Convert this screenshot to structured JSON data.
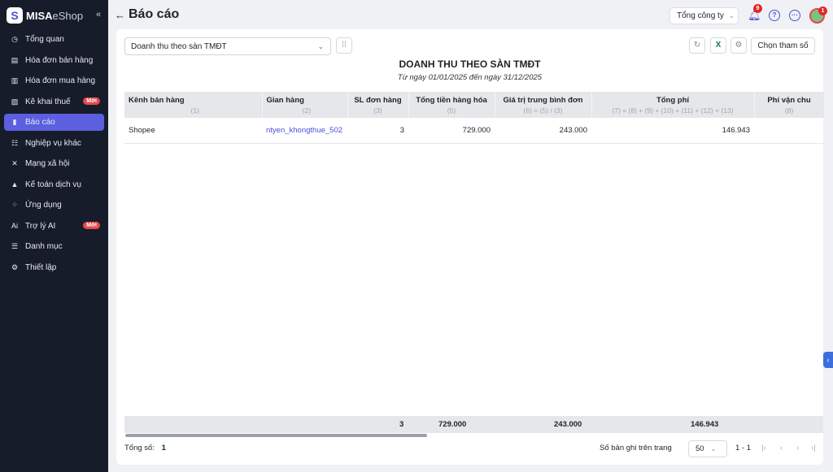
{
  "brand": {
    "mark": "S",
    "name_bold": "MISA",
    "name_light": "eShop"
  },
  "sidebar": {
    "items": [
      {
        "label": "Tổng quan",
        "icon": "◷",
        "name": "dashboard"
      },
      {
        "label": "Hóa đơn bán hàng",
        "icon": "▤",
        "name": "sales-invoice"
      },
      {
        "label": "Hóa đơn mua hàng",
        "icon": "▥",
        "name": "purchase-invoice"
      },
      {
        "label": "Kê khai thuế",
        "icon": "▧",
        "name": "tax",
        "badge": "Mới"
      },
      {
        "label": "Báo cáo",
        "icon": "▮",
        "name": "report"
      },
      {
        "label": "Nghiệp vụ khác",
        "icon": "☷",
        "name": "other-ops"
      },
      {
        "label": "Mạng xã hội",
        "icon": "✕",
        "name": "social"
      },
      {
        "label": "Kế toán dịch vụ",
        "icon": "▲",
        "name": "accounting-service"
      },
      {
        "label": "Ứng dụng",
        "icon": "⁘",
        "name": "apps"
      },
      {
        "label": "Trợ lý AI",
        "icon": "Ai",
        "name": "ai-assistant",
        "badge": "Mới"
      },
      {
        "label": "Danh mục",
        "icon": "☰",
        "name": "catalog"
      },
      {
        "label": "Thiết lập",
        "icon": "⚙",
        "name": "settings"
      }
    ]
  },
  "header": {
    "title": "Báo cáo",
    "company": "Tổng công ty",
    "notif_count": "9",
    "avatar_badge": "1"
  },
  "toolbar": {
    "report_type": "Doanh thu theo sàn TMĐT",
    "param_button": "Chọn tham số"
  },
  "report": {
    "title": "DOANH THU THEO SÀN TMĐT",
    "subtitle": "Từ ngày 01/01/2025 đến ngày 31/12/2025"
  },
  "table": {
    "columns": [
      {
        "label": "Kênh bán hàng",
        "sub": "(1)"
      },
      {
        "label": "Gian hàng",
        "sub": "(2)"
      },
      {
        "label": "SL đơn hàng",
        "sub": "(3)"
      },
      {
        "label": "Tổng tiền hàng hóa",
        "sub": "(5)"
      },
      {
        "label": "Giá trị trung bình đơn",
        "sub": "(6) = (5) / (3)"
      },
      {
        "label": "Tổng phí",
        "sub": "(7) = (8) + (9) + (10) + (11) + (12) + (13)"
      },
      {
        "label": "Phí vận chu",
        "sub": "(8)"
      }
    ],
    "rows": [
      {
        "channel": "Shopee",
        "shop": "ntyen_khongthue_502",
        "orders": "3",
        "goods_total": "729.000",
        "avg_order": "243.000",
        "total_fee": "146.943"
      }
    ],
    "totals": {
      "orders": "3",
      "goods_total": "729.000",
      "avg_order": "243.000",
      "total_fee": "146.943"
    }
  },
  "footer": {
    "total_label": "Tổng số:",
    "total_value": "1",
    "per_page_label": "Số bản ghi trên trang",
    "per_page": "50",
    "range": "1 - 1"
  }
}
